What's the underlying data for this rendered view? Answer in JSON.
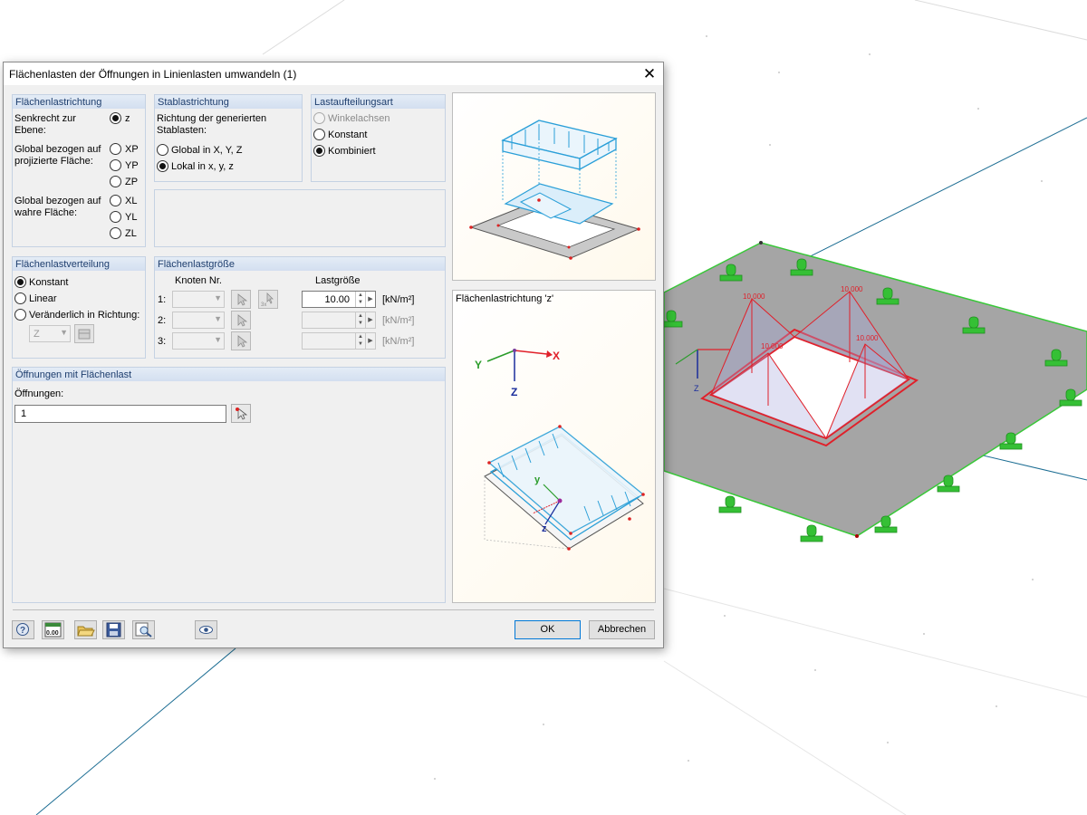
{
  "dialog": {
    "title": "Flächenlasten der Öffnungen in Linienlasten umwandeln   (1)",
    "close_glyph": "✕"
  },
  "flaechenlastrichtung": {
    "header": "Flächenlastrichtung",
    "senkrecht_label": "Senkrecht zur Ebene:",
    "opt_z": "z",
    "global_proj_label": "Global bezogen auf projizierte Fläche:",
    "opt_xp": "XP",
    "opt_yp": "YP",
    "opt_zp": "ZP",
    "global_wahr_label": "Global bezogen auf wahre Fläche:",
    "opt_xl": "XL",
    "opt_yl": "YL",
    "opt_zl": "ZL",
    "selected": "z"
  },
  "stablastrichtung": {
    "header": "Stablastrichtung",
    "desc": "Richtung der generierten Stablasten:",
    "opt_global": "Global in X, Y, Z",
    "opt_lokal": "Lokal in x, y, z",
    "selected": "lokal"
  },
  "lastaufteilungsart": {
    "header": "Lastaufteilungsart",
    "opt_winkel": "Winkelachsen",
    "opt_konstant": "Konstant",
    "opt_kombiniert": "Kombiniert",
    "selected": "kombiniert"
  },
  "verteilung": {
    "header": "Flächenlastverteilung",
    "opt_konstant": "Konstant",
    "opt_linear": "Linear",
    "opt_veraenderlich": "Veränderlich in Richtung:",
    "direction_value": "Z",
    "selected": "konstant"
  },
  "groesse": {
    "header": "Flächenlastgröße",
    "col_knoten": "Knoten Nr.",
    "col_last": "Lastgröße",
    "rows": [
      {
        "idx": "1:",
        "value": "10.00",
        "unit": "[kN/m²]"
      },
      {
        "idx": "2:",
        "value": "",
        "unit": "[kN/m²]"
      },
      {
        "idx": "3:",
        "value": "",
        "unit": "[kN/m²]"
      }
    ]
  },
  "oeffnungen": {
    "header": "Öffnungen mit Flächenlast",
    "label": "Öffnungen:",
    "value": "1"
  },
  "preview": {
    "bottom_title": "Flächenlastrichtung 'z'"
  },
  "viewport": {
    "load_labels": [
      "10.000",
      "10.000",
      "10.000",
      "10.000"
    ],
    "axis_x": "X",
    "axis_z": "Z"
  },
  "footer": {
    "ok": "OK",
    "cancel": "Abbrechen",
    "tool_values_text": "0.00"
  },
  "colors": {
    "accent_blue": "#1e3e6e",
    "load_blue": "#2a9fd8",
    "model_red": "#e0202a",
    "support_green": "#35c035",
    "slab_gray": "#a5a5a5"
  }
}
